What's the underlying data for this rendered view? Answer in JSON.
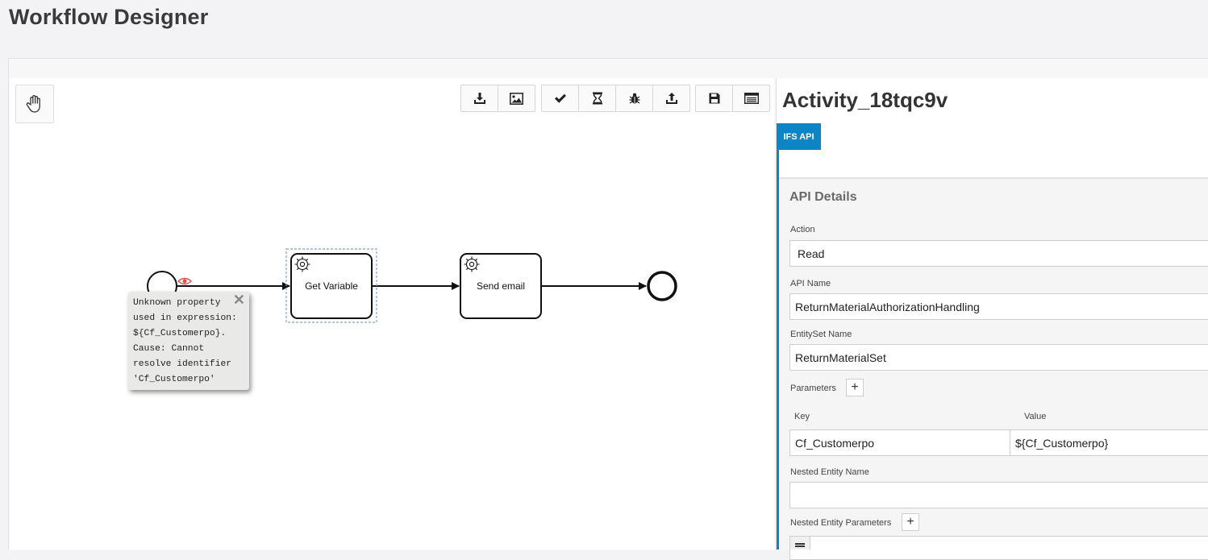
{
  "page": {
    "title": "Workflow Designer"
  },
  "toolbar": {
    "hand_tool": "hand-icon",
    "group1": [
      "download-icon",
      "image-icon"
    ],
    "group2": [
      "check-icon",
      "hourglass-icon",
      "bug-icon",
      "upload-icon"
    ],
    "group3": [
      "save-icon",
      "console-icon"
    ]
  },
  "diagram": {
    "tasks": [
      {
        "label": "Get Variable"
      },
      {
        "label": "Send email"
      }
    ],
    "tooltip": {
      "text": "Unknown property\nused in expression:\n${Cf_Customerpo}.\nCause: Cannot\nresolve identifier\n'Cf_Customerpo'",
      "close": "✕"
    }
  },
  "properties": {
    "title": "Activity_18tqc9v",
    "tab": "IFS API",
    "section_title": "API Details",
    "action": {
      "label": "Action",
      "value": "Read"
    },
    "api_name": {
      "label": "API Name",
      "value": "ReturnMaterialAuthorizationHandling"
    },
    "entityset": {
      "label": "EntitySet Name",
      "value": "ReturnMaterialSet"
    },
    "parameters": {
      "label": "Parameters",
      "add": "+",
      "key_header": "Key",
      "value_header": "Value",
      "rows": [
        {
          "key": "Cf_Customerpo",
          "value": "${Cf_Customerpo}"
        }
      ]
    },
    "nested_entity": {
      "label": "Nested Entity Name",
      "value": ""
    },
    "nested_params": {
      "label": "Nested Entity Parameters",
      "add": "+"
    }
  },
  "colors": {
    "accent": "#0d84c6",
    "selection": "#7aa7d8",
    "error_eye": "#d9534f"
  }
}
